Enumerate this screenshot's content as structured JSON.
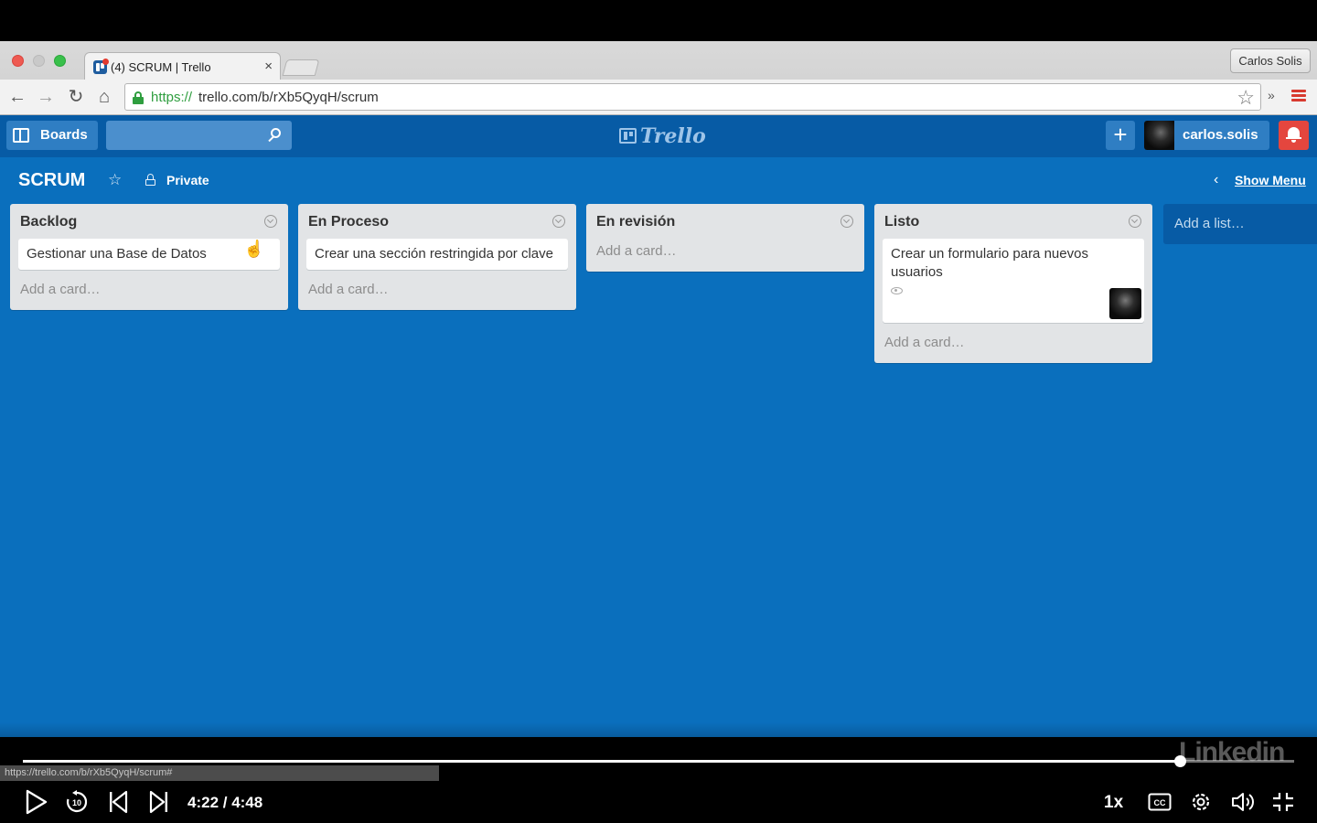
{
  "browser": {
    "tab_title": "(4) SCRUM | Trello",
    "tab_close": "×",
    "profile_name": "Carlos Solis",
    "url_scheme": "https://",
    "url_rest": "trello.com/b/rXb5QyqH/scrum",
    "ext_label": "»"
  },
  "trello": {
    "boards_label": "Boards",
    "search_value": "",
    "logo_text": "Trello",
    "add_label": "+",
    "member_name": "carlos.solis",
    "board_title": "SCRUM",
    "visibility": "Private",
    "show_menu": "Show Menu",
    "show_menu_chevron": "‹",
    "add_list": "Add a list…",
    "lists": [
      {
        "title": "Backlog",
        "cards": [
          "Gestionar una Base de Datos"
        ],
        "add_card": "Add a card…"
      },
      {
        "title": "En Proceso",
        "cards": [
          "Crear una sección restringida por clave"
        ],
        "add_card": "Add a card…"
      },
      {
        "title": "En revisión",
        "cards": [],
        "add_card": "Add a card…"
      },
      {
        "title": "Listo",
        "cards": [
          "Crear un formulario para nuevos usuarios"
        ],
        "add_card": "Add a card…"
      }
    ]
  },
  "player": {
    "status_url": "https://trello.com/b/rXb5QyqH/scrum#",
    "watermark": "Linkedin",
    "time": "4:22 / 4:48",
    "speed": "1x",
    "progress": 0.91
  },
  "colors": {
    "board_bg": "#0a6fbd",
    "header_bg": "#075ba5",
    "notification": "#e4463e",
    "secure_green": "#2f9e3f"
  },
  "icons": [
    "back-arrow-icon",
    "forward-arrow-icon",
    "reload-icon",
    "home-icon",
    "lock-icon",
    "star-icon",
    "menu-icon",
    "boards-icon",
    "search-icon",
    "bell-icon",
    "list-menu-icon",
    "watch-icon",
    "play-icon",
    "replay-10-icon",
    "skip-previous-icon",
    "skip-next-icon",
    "closed-captions-icon",
    "settings-icon",
    "volume-icon",
    "exit-fullscreen-icon"
  ]
}
